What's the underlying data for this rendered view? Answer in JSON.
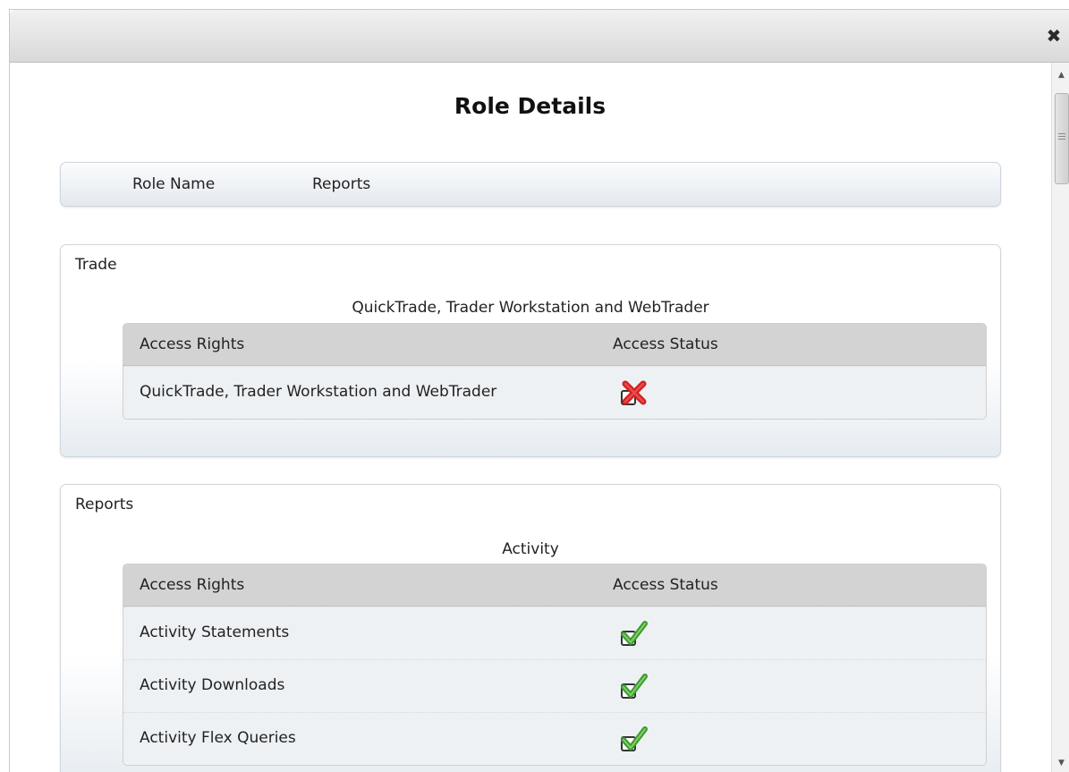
{
  "dialog": {
    "close_symbol": "✖"
  },
  "page_title": "Role Details",
  "role": {
    "label": "Role Name",
    "value": "Reports"
  },
  "sections": [
    {
      "title": "Trade",
      "subheading": "QuickTrade, Trader Workstation and WebTrader",
      "header": {
        "rights": "Access Rights",
        "status": "Access Status"
      },
      "rows": [
        {
          "right": "QuickTrade, Trader Workstation and WebTrader",
          "status": "denied",
          "icon": "denied-x-icon"
        }
      ]
    },
    {
      "title": "Reports",
      "subheading": "Activity",
      "header": {
        "rights": "Access Rights",
        "status": "Access Status"
      },
      "rows": [
        {
          "right": "Activity Statements",
          "status": "granted",
          "icon": "granted-check-icon"
        },
        {
          "right": "Activity Downloads",
          "status": "granted",
          "icon": "granted-check-icon"
        },
        {
          "right": "Activity Flex Queries",
          "status": "granted",
          "icon": "granted-check-icon"
        }
      ]
    }
  ],
  "colors": {
    "granted": "#4aa83a",
    "denied": "#d42020"
  }
}
